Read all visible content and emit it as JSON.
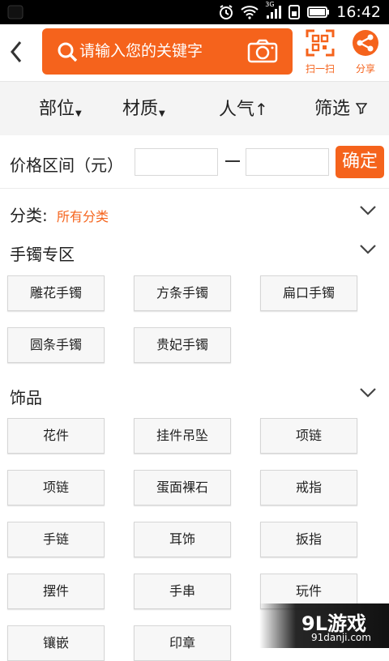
{
  "status_bar": {
    "time": "16:42",
    "network": "3G"
  },
  "search": {
    "placeholder": "请输入您的关键字"
  },
  "toolbar": {
    "scan_label": "扫一扫",
    "share_label": "分享"
  },
  "filters": [
    {
      "label": "部位"
    },
    {
      "label": "材质"
    },
    {
      "label": "人气"
    },
    {
      "label": "筛选"
    }
  ],
  "price": {
    "label": "价格区间（元）",
    "min_value": "",
    "max_value": "",
    "confirm_label": "确定"
  },
  "category": {
    "label": "分类:",
    "value": "所有分类"
  },
  "sections": [
    {
      "title": "手镯专区",
      "items": [
        "雕花手镯",
        "方条手镯",
        "扁口手镯",
        "圆条手镯",
        "贵妃手镯"
      ]
    },
    {
      "title": "饰品",
      "items": [
        "花件",
        "挂件吊坠",
        "项链",
        "项链",
        "蛋面裸石",
        "戒指",
        "手链",
        "耳饰",
        "扳指",
        "摆件",
        "手串",
        "玩件",
        "镶嵌",
        "印章"
      ]
    }
  ],
  "watermark": {
    "logo": "9L游戏",
    "url": "91danji.com"
  },
  "colors": {
    "accent": "#f5631c",
    "filter_bg": "#f4f4f4"
  },
  "icons": [
    "back-arrow-icon",
    "search-icon",
    "camera-icon",
    "qr-scan-icon",
    "share-icon",
    "filter-funnel-icon",
    "chevron-down-icon"
  ]
}
